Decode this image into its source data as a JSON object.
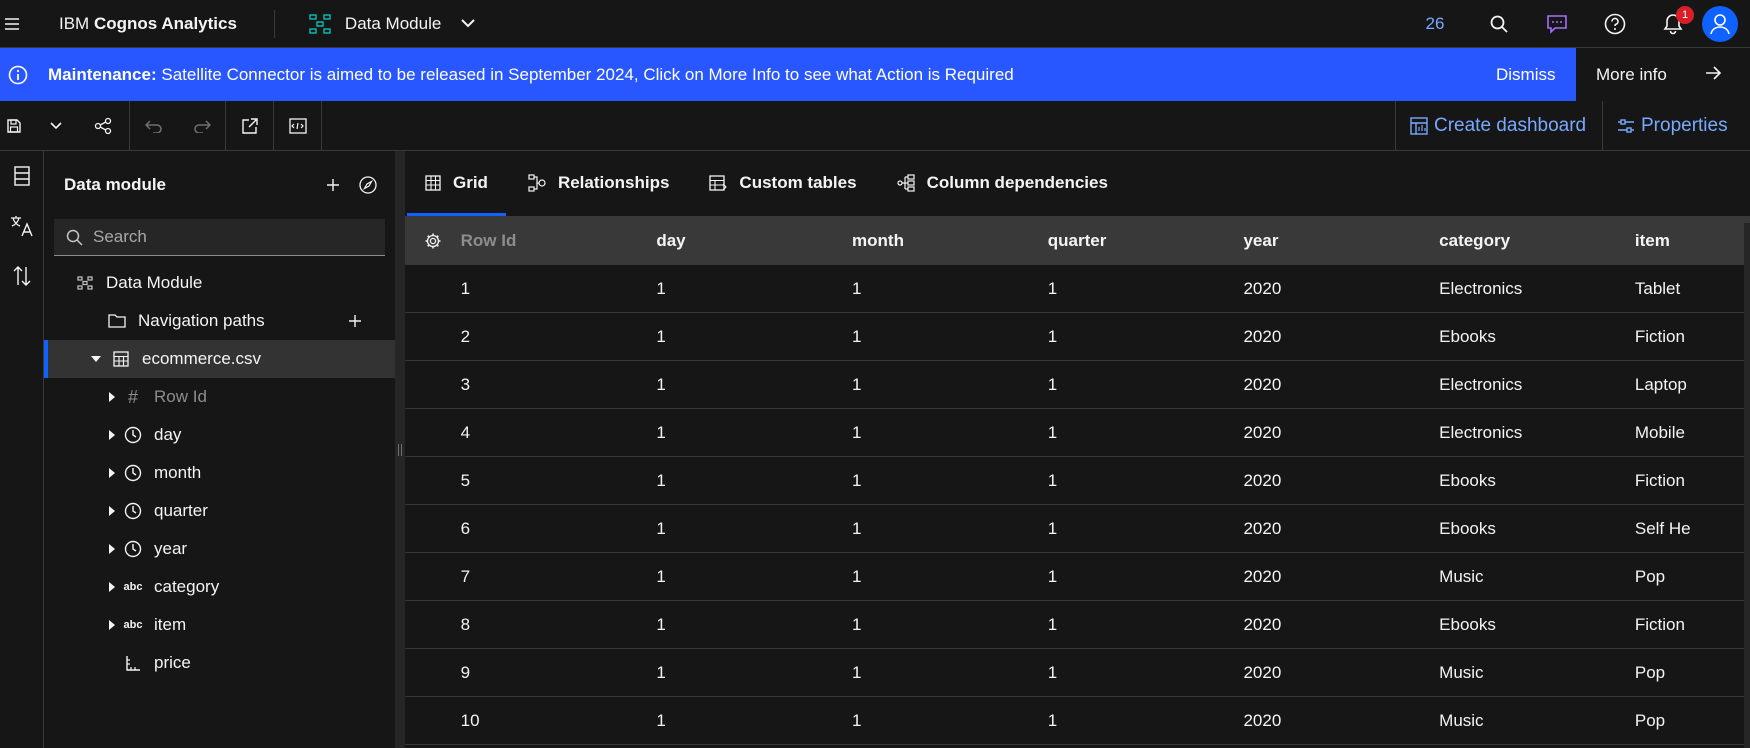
{
  "topbar": {
    "brand_prefix": "IBM",
    "brand_name": "Cognos Analytics",
    "module_label": "Data Module",
    "count": "26",
    "notification_count": "1",
    "icons": [
      "menu-icon",
      "data-module-icon",
      "chevron-down-icon",
      "search-icon",
      "chat-icon",
      "help-icon",
      "notification-icon",
      "user-avatar-icon"
    ]
  },
  "banner": {
    "label": "Maintenance:",
    "message": "Satellite Connector is aimed to be released in September 2024, Click on More Info to see what Action is Required",
    "dismiss": "Dismiss",
    "more_info": "More info",
    "color": "#2957ff"
  },
  "toolbar": {
    "create_dashboard": "Create dashboard",
    "properties": "Properties",
    "link_color": "#78a9ff"
  },
  "panel": {
    "title": "Data module",
    "search_placeholder": "Search",
    "tree": {
      "root": "Data Module",
      "navigation_paths": "Navigation paths",
      "table": "ecommerce.csv",
      "columns": [
        {
          "label": "Row Id",
          "icon": "#"
        },
        {
          "label": "day",
          "icon": "clock"
        },
        {
          "label": "month",
          "icon": "clock"
        },
        {
          "label": "quarter",
          "icon": "clock"
        },
        {
          "label": "year",
          "icon": "clock"
        },
        {
          "label": "category",
          "icon": "abc"
        },
        {
          "label": "item",
          "icon": "abc"
        },
        {
          "label": "price",
          "icon": "measure"
        }
      ]
    }
  },
  "tabs": [
    "Grid",
    "Relationships",
    "Custom tables",
    "Column dependencies"
  ],
  "grid": {
    "headers": [
      "Row Id",
      "day",
      "month",
      "quarter",
      "year",
      "category",
      "item"
    ],
    "rows": [
      [
        "1",
        "1",
        "1",
        "1",
        "2020",
        "Electronics",
        "Tablet"
      ],
      [
        "2",
        "1",
        "1",
        "1",
        "2020",
        "Ebooks",
        "Fiction"
      ],
      [
        "3",
        "1",
        "1",
        "1",
        "2020",
        "Electronics",
        "Laptop"
      ],
      [
        "4",
        "1",
        "1",
        "1",
        "2020",
        "Electronics",
        "Mobile"
      ],
      [
        "5",
        "1",
        "1",
        "1",
        "2020",
        "Ebooks",
        "Fiction"
      ],
      [
        "6",
        "1",
        "1",
        "1",
        "2020",
        "Ebooks",
        "Self He"
      ],
      [
        "7",
        "1",
        "1",
        "1",
        "2020",
        "Music",
        "Pop"
      ],
      [
        "8",
        "1",
        "1",
        "1",
        "2020",
        "Ebooks",
        "Fiction"
      ],
      [
        "9",
        "1",
        "1",
        "1",
        "2020",
        "Music",
        "Pop"
      ],
      [
        "10",
        "1",
        "1",
        "1",
        "2020",
        "Music",
        "Pop"
      ]
    ]
  }
}
